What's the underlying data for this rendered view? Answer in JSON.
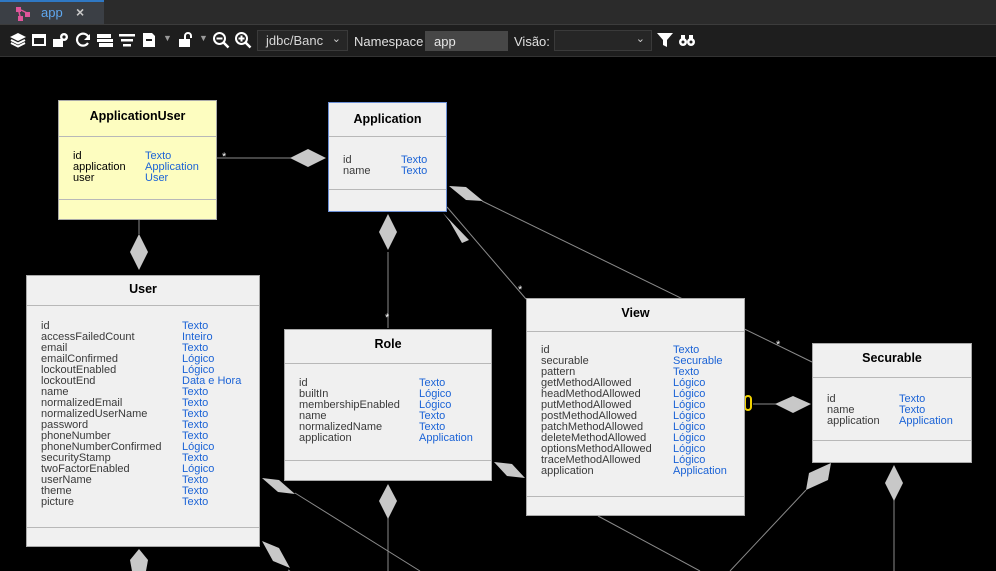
{
  "tab": {
    "label": "app",
    "close": "×"
  },
  "toolbar": {
    "jdbc_value": "jdbc/Banc",
    "namespace_label": "Namespace",
    "namespace_value": "app",
    "visao_label": "Visão:",
    "visao_value": ""
  },
  "entities": {
    "applicationuser": {
      "title": "ApplicationUser",
      "attrs": [
        {
          "name": "id",
          "type": "Texto"
        },
        {
          "name": "application",
          "type": "Application"
        },
        {
          "name": "user",
          "type": "User"
        }
      ]
    },
    "application": {
      "title": "Application",
      "attrs": [
        {
          "name": "id",
          "type": "Texto"
        },
        {
          "name": "name",
          "type": "Texto"
        }
      ]
    },
    "user": {
      "title": "User",
      "attrs": [
        {
          "name": "id",
          "type": "Texto"
        },
        {
          "name": "accessFailedCount",
          "type": "Inteiro"
        },
        {
          "name": "email",
          "type": "Texto"
        },
        {
          "name": "emailConfirmed",
          "type": "Lógico"
        },
        {
          "name": "lockoutEnabled",
          "type": "Lógico"
        },
        {
          "name": "lockoutEnd",
          "type": "Data e Hora"
        },
        {
          "name": "name",
          "type": "Texto"
        },
        {
          "name": "normalizedEmail",
          "type": "Texto"
        },
        {
          "name": "normalizedUserName",
          "type": "Texto"
        },
        {
          "name": "password",
          "type": "Texto"
        },
        {
          "name": "phoneNumber",
          "type": "Texto"
        },
        {
          "name": "phoneNumberConfirmed",
          "type": "Lógico"
        },
        {
          "name": "securityStamp",
          "type": "Texto"
        },
        {
          "name": "twoFactorEnabled",
          "type": "Lógico"
        },
        {
          "name": "userName",
          "type": "Texto"
        },
        {
          "name": "theme",
          "type": "Texto"
        },
        {
          "name": "picture",
          "type": "Texto"
        }
      ]
    },
    "role": {
      "title": "Role",
      "attrs": [
        {
          "name": "id",
          "type": "Texto"
        },
        {
          "name": "builtIn",
          "type": "Lógico"
        },
        {
          "name": "membershipEnabled",
          "type": "Lógico"
        },
        {
          "name": "name",
          "type": "Texto"
        },
        {
          "name": "normalizedName",
          "type": "Texto"
        },
        {
          "name": "application",
          "type": "Application"
        }
      ]
    },
    "view": {
      "title": "View",
      "attrs": [
        {
          "name": "id",
          "type": "Texto"
        },
        {
          "name": "securable",
          "type": "Securable"
        },
        {
          "name": "pattern",
          "type": "Texto"
        },
        {
          "name": "getMethodAllowed",
          "type": "Lógico"
        },
        {
          "name": "headMethodAllowed",
          "type": "Lógico"
        },
        {
          "name": "putMethodAllowed",
          "type": "Lógico"
        },
        {
          "name": "postMethodAllowed",
          "type": "Lógico"
        },
        {
          "name": "patchMethodAllowed",
          "type": "Lógico"
        },
        {
          "name": "deleteMethodAllowed",
          "type": "Lógico"
        },
        {
          "name": "optionsMethodAllowed",
          "type": "Lógico"
        },
        {
          "name": "traceMethodAllowed",
          "type": "Lógico"
        },
        {
          "name": "application",
          "type": "Application"
        }
      ]
    },
    "securable": {
      "title": "Securable",
      "attrs": [
        {
          "name": "id",
          "type": "Texto"
        },
        {
          "name": "name",
          "type": "Texto"
        },
        {
          "name": "application",
          "type": "Application"
        }
      ]
    }
  },
  "multiplicity": "*",
  "colors": {
    "accent": "#2f78c4",
    "type_text": "#1b63d6",
    "entity_bg": "#f0f0f0",
    "entity_highlight": "#fdfdc0"
  }
}
